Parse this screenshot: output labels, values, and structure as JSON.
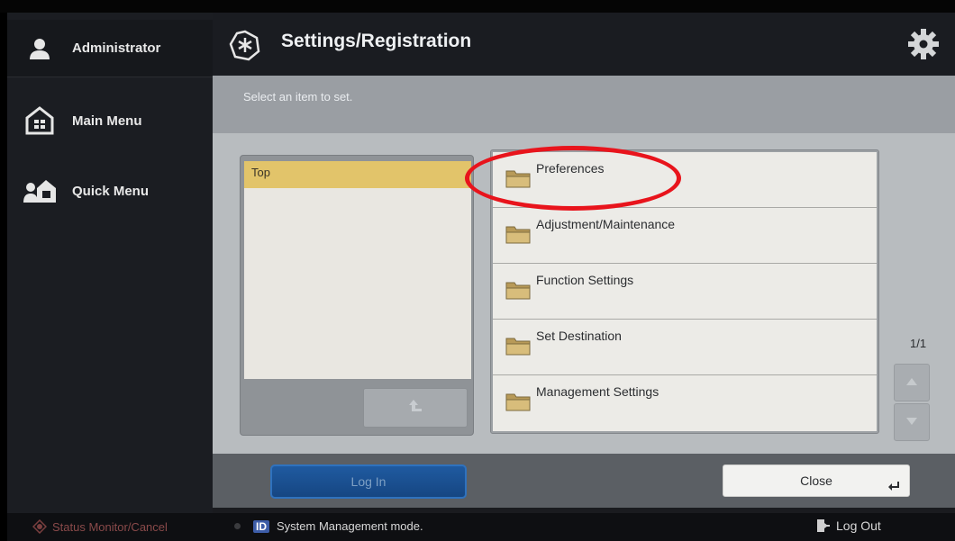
{
  "sidebar": {
    "items": [
      {
        "label": "Administrator",
        "icon": "user-icon"
      },
      {
        "label": "Main Menu",
        "icon": "home-icon"
      },
      {
        "label": "Quick Menu",
        "icon": "quick-menu-icon"
      }
    ]
  },
  "header": {
    "title": "Settings/Registration",
    "icon": "settings-registration-icon",
    "right_icon": "gear-icon"
  },
  "main": {
    "instruction": "Select an item to set.",
    "tree": {
      "selected": "Top"
    },
    "folders": [
      {
        "label": "Preferences"
      },
      {
        "label": "Adjustment/Maintenance"
      },
      {
        "label": "Function Settings"
      },
      {
        "label": "Set Destination"
      },
      {
        "label": "Management Settings"
      }
    ],
    "page": "1/1"
  },
  "actions": {
    "login_label": "Log In",
    "close_label": "Close"
  },
  "status": {
    "monitor_label": "Status Monitor/Cancel",
    "id_badge": "ID",
    "mode_text": "System Management mode.",
    "logout_label": "Log Out"
  },
  "colors": {
    "selected_row": "#e2c46a",
    "login_button": "#1f5aa0",
    "annotation": "#e8141c"
  }
}
